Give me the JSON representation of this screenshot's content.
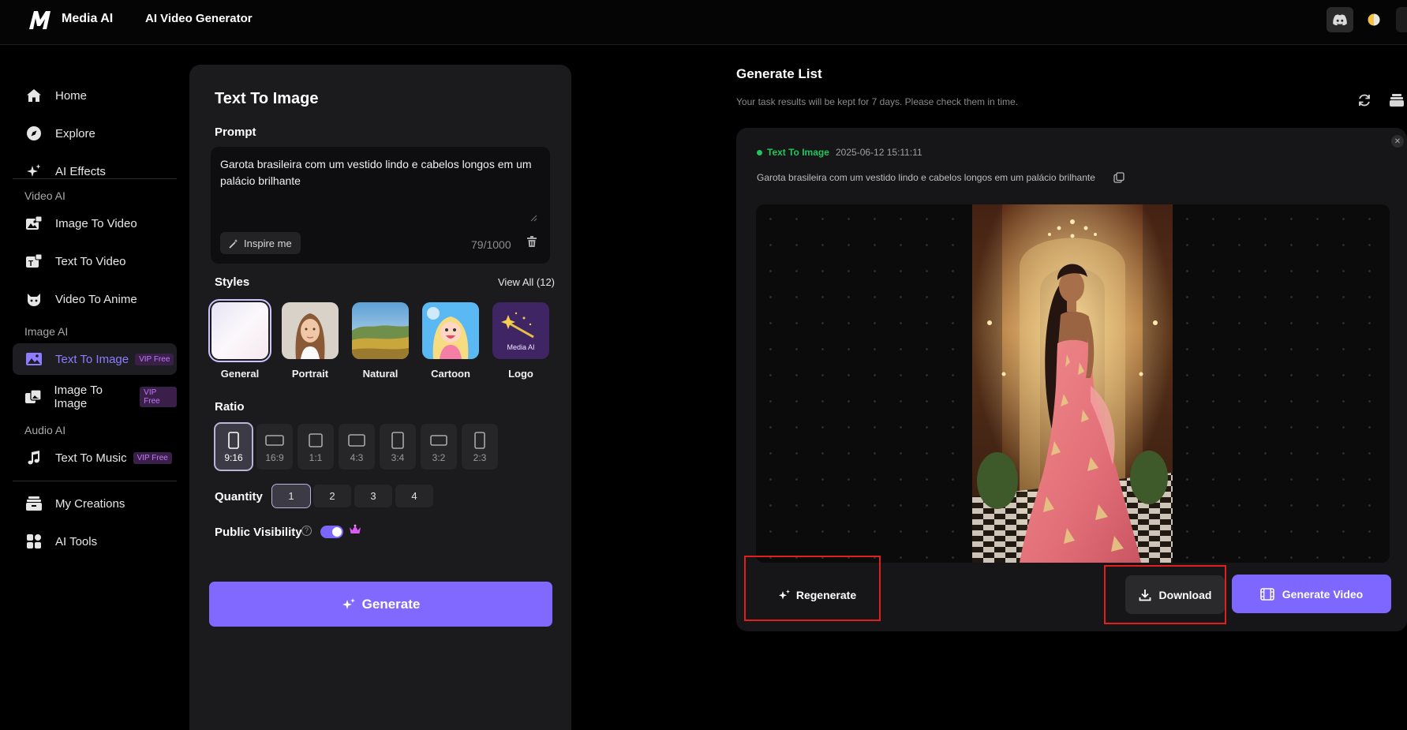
{
  "topbar": {
    "app_name": "Media AI",
    "page_name": "AI Video Generator",
    "logo_letter": "M"
  },
  "sidebar": {
    "items": [
      {
        "label": "Home",
        "icon": "home-icon"
      },
      {
        "label": "Explore",
        "icon": "compass-icon"
      },
      {
        "label": "AI Effects",
        "icon": "sparkle-icon"
      },
      {
        "label": "Image To Video",
        "icon": "image-video-icon"
      },
      {
        "label": "Text To Video",
        "icon": "text-video-icon"
      },
      {
        "label": "Video To Anime",
        "icon": "anime-icon"
      },
      {
        "label": "Text To Image",
        "icon": "text-image-icon",
        "badge": "VIP Free",
        "active": true
      },
      {
        "label": "Image To Image",
        "icon": "image-image-icon",
        "badge": "VIP Free"
      },
      {
        "label": "Text To Music",
        "icon": "music-icon",
        "badge": "VIP Free"
      },
      {
        "label": "My Creations",
        "icon": "stack-icon"
      },
      {
        "label": "AI Tools",
        "icon": "grid-icon"
      }
    ],
    "sections": {
      "video": "Video AI",
      "image": "Image AI",
      "audio": "Audio AI"
    }
  },
  "form": {
    "title": "Text To Image",
    "prompt_label": "Prompt",
    "prompt_value": "Garota brasileira com um vestido lindo e cabelos longos em um palácio brilhante",
    "inspire_label": "Inspire me",
    "char_count": "79/1000",
    "styles_label": "Styles",
    "view_all": "View All (12)",
    "styles": [
      {
        "name": "General",
        "selected": true
      },
      {
        "name": "Portrait"
      },
      {
        "name": "Natural"
      },
      {
        "name": "Cartoon"
      },
      {
        "name": "Logo",
        "thumb_text": "Media AI"
      }
    ],
    "ratio_label": "Ratio",
    "ratios": [
      {
        "label": "9:16",
        "selected": true
      },
      {
        "label": "16:9"
      },
      {
        "label": "1:1"
      },
      {
        "label": "4:3"
      },
      {
        "label": "3:4"
      },
      {
        "label": "3:2"
      },
      {
        "label": "2:3"
      }
    ],
    "quantity_label": "Quantity",
    "quantities": [
      "1",
      "2",
      "3",
      "4"
    ],
    "quantity_selected": "1",
    "visibility_label": "Public Visibility",
    "visibility_on": true,
    "generate_label": "Generate"
  },
  "generate_list": {
    "title": "Generate List",
    "note": "Your task results will be kept for 7 days. Please check them in time.",
    "task": {
      "type": "Text To Image",
      "time": "2025-06-12 15:11:11",
      "prompt": "Garota brasileira com um vestido lindo e cabelos longos em um palácio brilhante",
      "status": "completed"
    },
    "regenerate_label": "Regenerate",
    "download_label": "Download",
    "generate_video_label": "Generate Video"
  },
  "colors": {
    "accent": "#8169ff",
    "active_nav_text": "#8d7cff",
    "status_green": "#22c55e",
    "vip_badge": "#c178ff",
    "highlight_box": "#e0201d"
  }
}
